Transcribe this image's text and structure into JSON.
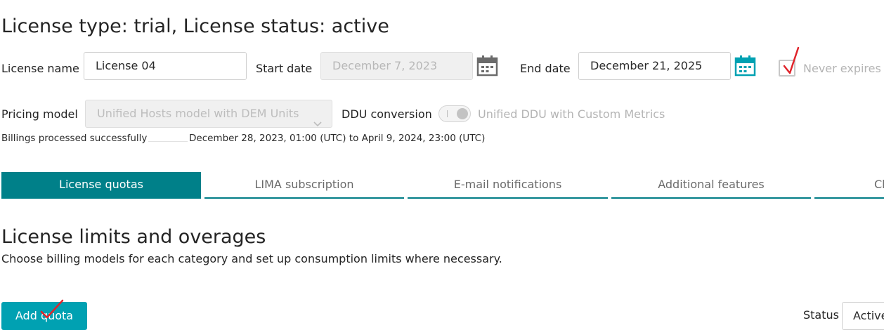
{
  "header": {
    "title": "License type: trial, License status: active"
  },
  "form": {
    "license_name_label": "License name",
    "license_name_value": "License 04",
    "start_date_label": "Start date",
    "start_date_value": "December 7, 2023",
    "end_date_label": "End date",
    "end_date_value": "December 21, 2025",
    "never_expires_label": "Never expires",
    "never_expires_checked": true,
    "pricing_model_label": "Pricing model",
    "pricing_model_value": "Unified Hosts model with DEM Units",
    "ddu_conversion_label": "DDU conversion",
    "ddu_toggle_label": "Unified DDU with Custom Metrics",
    "billing_status": "Billings processed successfully",
    "billing_period": "December 28, 2023, 01:00 (UTC) to April 9, 2024, 23:00 (UTC)"
  },
  "tabs": [
    {
      "label": "License quotas",
      "active": true
    },
    {
      "label": "LIMA subscription",
      "active": false
    },
    {
      "label": "E-mail notifications",
      "active": false
    },
    {
      "label": "Additional features",
      "active": false
    },
    {
      "label": "Cl",
      "active": false
    }
  ],
  "section": {
    "heading": "License limits and overages",
    "description": "Choose billing models for each category and set up consumption limits where necessary."
  },
  "actions": {
    "add_quota_label": "Add quota",
    "status_label": "Status",
    "status_value": "Active"
  },
  "icons": {
    "start_calendar": "calendar-icon",
    "end_calendar": "calendar-icon",
    "pricing_chevron": "chevron-down-icon",
    "annotation_check": "red-check-annotation"
  },
  "colors": {
    "accent_teal": "#008089",
    "primary_button": "#00a1b2",
    "end_calendar_icon": "#00a1b2",
    "start_calendar_icon": "#6b6b6b",
    "annotation_red": "#e0242b"
  }
}
